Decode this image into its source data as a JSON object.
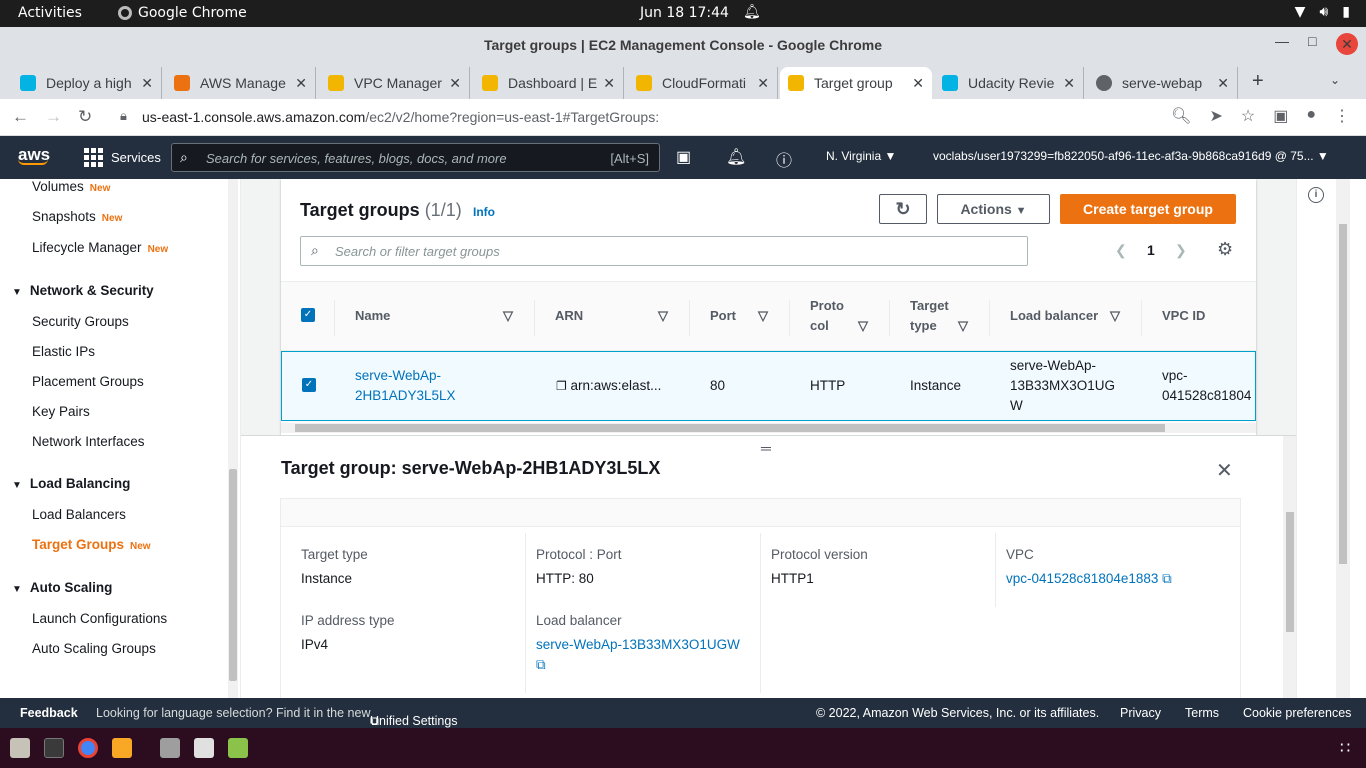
{
  "os": {
    "activities": "Activities",
    "app_name": "Google Chrome",
    "clock": "Jun 18  17:44"
  },
  "window": {
    "title": "Target groups | EC2 Management Console - Google Chrome"
  },
  "tabs": [
    {
      "label": "Deploy a high",
      "icon_color": "#02b3e4"
    },
    {
      "label": "AWS Manage",
      "icon_color": "#ec7211"
    },
    {
      "label": "VPC Manager",
      "icon_color": "#f2b600"
    },
    {
      "label": "Dashboard | E",
      "icon_color": "#f2b600"
    },
    {
      "label": "CloudFormati",
      "icon_color": "#f2b600"
    },
    {
      "label": "Target group",
      "icon_color": "#f2b600",
      "active": true
    },
    {
      "label": "Udacity Revie",
      "icon_color": "#02b3e4"
    },
    {
      "label": "serve-webap",
      "icon_color": "#5f6368"
    }
  ],
  "address": {
    "host": "us-east-1.console.aws.amazon.com",
    "path": "/ec2/v2/home?region=us-east-1#TargetGroups:"
  },
  "awsnav": {
    "logo": "aws",
    "services": "Services",
    "search_placeholder": "Search for services, features, blogs, docs, and more",
    "search_shortcut": "[Alt+S]",
    "region": "N. Virginia",
    "account": "voclabs/user1973299=fb822050-af96-11ec-af3a-9b868ca916d9 @ 75..."
  },
  "sidebar": {
    "items": [
      {
        "label": "Volumes",
        "new": "New"
      },
      {
        "label": "Snapshots",
        "new": "New"
      },
      {
        "label": "Lifecycle Manager",
        "new": "New"
      }
    ],
    "net_head": "Network & Security",
    "net_items": [
      "Security Groups",
      "Elastic IPs",
      "Placement Groups",
      "Key Pairs",
      "Network Interfaces"
    ],
    "lb_head": "Load Balancing",
    "lb_items": [
      "Load Balancers",
      "Target Groups"
    ],
    "lb_new": "New",
    "as_head": "Auto Scaling",
    "as_items": [
      "Launch Configurations",
      "Auto Scaling Groups"
    ]
  },
  "main": {
    "title": "Target groups",
    "count": "(1/1)",
    "info": "Info",
    "actions_label": "Actions",
    "create_label": "Create target group",
    "filter_placeholder": "Search or filter target groups",
    "page": "1",
    "columns": {
      "name": "Name",
      "arn": "ARN",
      "port": "Port",
      "protocol_1": "Proto",
      "protocol_2": "col",
      "target_type_1": "Target",
      "target_type_2": "type",
      "load_balancer": "Load balancer",
      "vpc_id": "VPC ID"
    },
    "row": {
      "name_1": "serve-WebAp-",
      "name_2": "2HB1ADY3L5LX",
      "arn": "arn:aws:elast...",
      "port": "80",
      "protocol": "HTTP",
      "target_type": "Instance",
      "lb_1": "serve-WebAp-",
      "lb_2": "13B33MX3O1UG",
      "lb_3": "W",
      "vpc_1": "vpc-",
      "vpc_2": "041528c81804"
    }
  },
  "details": {
    "title": "Target group: serve-WebAp-2HB1ADY3L5LX",
    "target_type_label": "Target type",
    "target_type": "Instance",
    "protocol_port_label": "Protocol : Port",
    "protocol_port": "HTTP: 80",
    "protocol_version_label": "Protocol version",
    "protocol_version": "HTTP1",
    "vpc_label": "VPC",
    "vpc": "vpc-041528c81804e1883",
    "ip_type_label": "IP address type",
    "ip_type": "IPv4",
    "lb_label": "Load balancer",
    "lb": "serve-WebAp-13B33MX3O1UGW"
  },
  "footer": {
    "feedback": "Feedback",
    "lang_text": "Looking for language selection? Find it in the new",
    "unified": "Unified Settings",
    "copyright": "© 2022, Amazon Web Services, Inc. or its affiliates.",
    "privacy": "Privacy",
    "terms": "Terms",
    "cookies": "Cookie preferences"
  }
}
